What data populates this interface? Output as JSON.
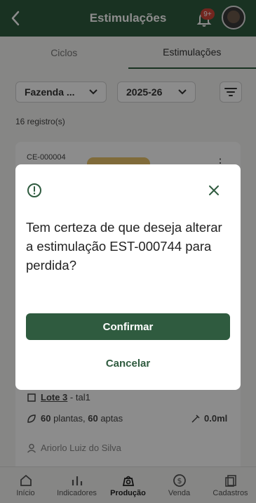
{
  "header": {
    "title": "Estimulações",
    "notification_badge": "9+"
  },
  "tabs": [
    {
      "label": "Ciclos",
      "active": false
    },
    {
      "label": "Estimulações",
      "active": true
    }
  ],
  "filters": {
    "farm": "Fazenda ...",
    "season": "2025-26"
  },
  "records_count": "16 registro(s)",
  "card": {
    "code": "CE-000004",
    "lote_link": "Lote 3",
    "lote_suffix": " - tal1",
    "plants": "60",
    "plants_word": " plantas, ",
    "aptas": "60",
    "aptas_word": " aptas",
    "volume": "0.0ml",
    "person": "Ariorlo Luiz do Silva"
  },
  "dialog": {
    "message": "Tem certeza de que deseja alterar a estimulação EST-000744 para perdida?",
    "confirm_label": "Confirmar",
    "cancel_label": "Cancelar"
  },
  "bottom_nav": [
    {
      "label": "Início",
      "icon": "home-icon",
      "active": false
    },
    {
      "label": "Indicadores",
      "icon": "bar-chart-icon",
      "active": false
    },
    {
      "label": "Produção",
      "icon": "production-icon",
      "active": true
    },
    {
      "label": "Venda",
      "icon": "dollar-icon",
      "active": false
    },
    {
      "label": "Cadastros",
      "icon": "records-icon",
      "active": false
    }
  ],
  "colors": {
    "primary": "#2f5b3f",
    "badge": "#d0453a",
    "chip": "#e9c46a"
  }
}
